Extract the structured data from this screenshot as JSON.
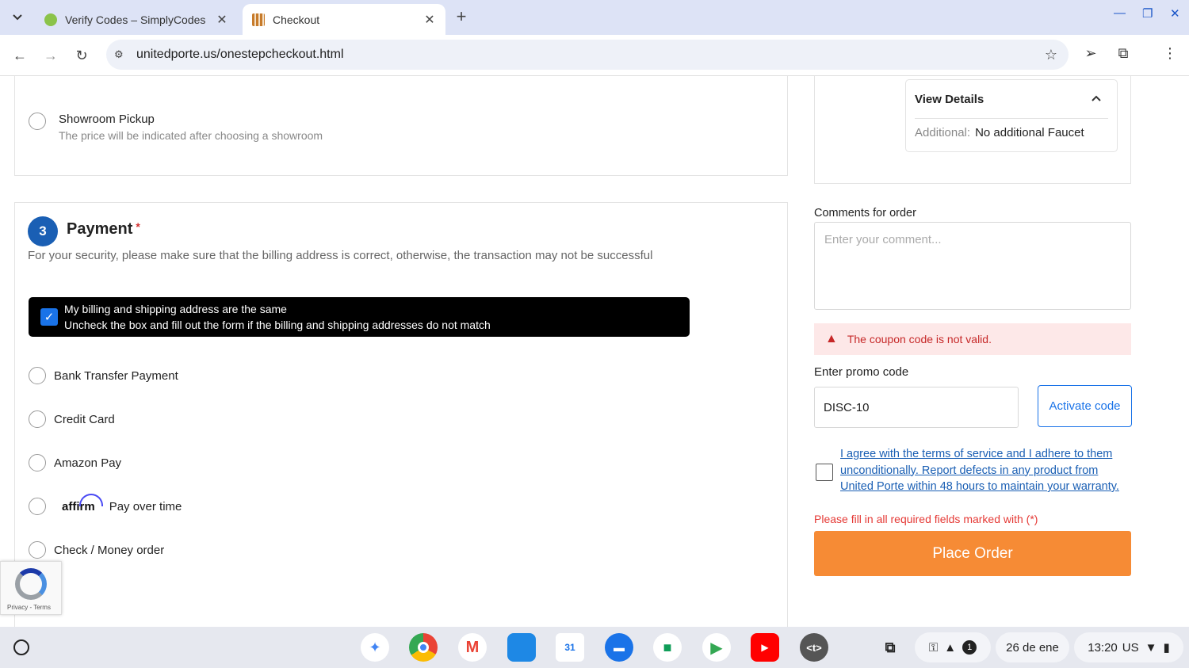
{
  "tabs": [
    {
      "title": "Verify Codes – SimplyCodes",
      "close": "✕"
    },
    {
      "title": "Checkout",
      "close": "✕"
    }
  ],
  "toolbar": {
    "url": "unitedporte.us/onestepcheckout.html"
  },
  "shipping": {
    "showroom_label": "Showroom Pickup",
    "showroom_sub": "The price will be indicated after choosing a showroom"
  },
  "payment": {
    "step": "3",
    "title": "Payment",
    "required_mark": "*",
    "security_note": "For your security, please make sure that the billing address is correct, otherwise, the transaction may not be successful",
    "billing_same_line1": "My billing and shipping address are the same",
    "billing_same_line2": "Uncheck the box and fill out the form if the billing and shipping addresses do not match",
    "methods": [
      {
        "label": "Bank Transfer Payment"
      },
      {
        "label": "Credit Card"
      },
      {
        "label": "Amazon Pay"
      },
      {
        "label": "Pay over time",
        "logo": "affirm"
      },
      {
        "label": "Check / Money order"
      }
    ]
  },
  "order_summary": {
    "view_details": "View Details",
    "additional_key": "Additional:",
    "additional_value": "No additional Faucet"
  },
  "comments": {
    "label": "Comments for order",
    "placeholder": "Enter your comment..."
  },
  "coupon": {
    "error": "The coupon code is not valid.",
    "label": "Enter promo code",
    "value": "DISC-10",
    "button": "Activate code"
  },
  "terms": {
    "text": "I agree with the terms of service and I adhere to them unconditionally. Report defects in any product from United Porte within 48 hours to maintain your warranty."
  },
  "checkout": {
    "required_note": "Please fill in all required fields marked with (*)",
    "place_order": "Place Order"
  },
  "recaptcha": {
    "links": "Privacy - Terms"
  },
  "shelf": {
    "date": "26 de ene",
    "time": "13:20",
    "locale": "US",
    "notification_count": "1"
  },
  "colors": {
    "accent_blue": "#1a5fb4",
    "place_order": "#f68b35",
    "error": "#c62828"
  }
}
